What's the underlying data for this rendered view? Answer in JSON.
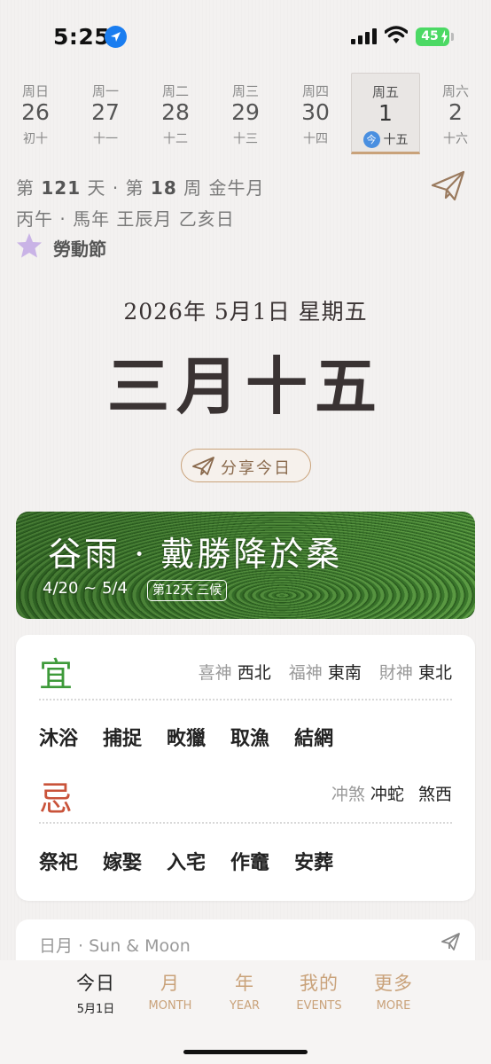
{
  "status_bar": {
    "time": "5:25",
    "battery": "45"
  },
  "week": [
    {
      "weekday": "周日",
      "date": "26",
      "lunar": "初十",
      "selected": false
    },
    {
      "weekday": "周一",
      "date": "27",
      "lunar": "十一",
      "selected": false
    },
    {
      "weekday": "周二",
      "date": "28",
      "lunar": "十二",
      "selected": false
    },
    {
      "weekday": "周三",
      "date": "29",
      "lunar": "十三",
      "selected": false
    },
    {
      "weekday": "周四",
      "date": "30",
      "lunar": "十四",
      "selected": false
    },
    {
      "weekday": "周五",
      "date": "1",
      "lunar": "十五",
      "selected": true,
      "badge": "今"
    },
    {
      "weekday": "周六",
      "date": "2",
      "lunar": "十六",
      "selected": false
    }
  ],
  "info": {
    "day_prefix": "第",
    "day_of_year": "121",
    "day_suffix": "天 · 第",
    "week_of_year": "18",
    "week_suffix": "周 金牛月",
    "ganzhi": "丙午 · 馬年 王辰月 乙亥日",
    "holiday": "勞動節"
  },
  "date": {
    "gregorian": "2026年 5月1日 星期五",
    "lunar": "三月十五"
  },
  "share_label": "分享今日",
  "solar_term": {
    "title": "谷雨 · 戴勝降於桑",
    "range": "4/20 ~ 5/4",
    "badge": "第12天 三候"
  },
  "yi_ji": {
    "yi_char": "宜",
    "ji_char": "忌",
    "xishen_label": "喜神",
    "xishen_val": "西北",
    "fushen_label": "福神",
    "fushen_val": "東南",
    "caishen_label": "財神",
    "caishen_val": "東北",
    "yi_items": [
      "沐浴",
      "捕捉",
      "畋獵",
      "取漁",
      "結網"
    ],
    "chongsha_label": "冲煞",
    "chong_val": "冲蛇",
    "sha_val": "煞西",
    "ji_items": [
      "祭祀",
      "嫁娶",
      "入宅",
      "作竈",
      "安葬"
    ]
  },
  "sun_moon": {
    "title": "日月 · Sun & Moon"
  },
  "tabs": [
    {
      "label": "今日",
      "sub": "5月1日",
      "active": true
    },
    {
      "label": "月",
      "sub": "MONTH",
      "active": false
    },
    {
      "label": "年",
      "sub": "YEAR",
      "active": false
    },
    {
      "label": "我的",
      "sub": "EVENTS",
      "active": false
    },
    {
      "label": "更多",
      "sub": "MORE",
      "active": false
    }
  ],
  "colors": {
    "accent": "#c9a27a",
    "yi": "#3e9a3a",
    "ji": "#c9533a",
    "today_badge": "#4a8fe0",
    "holiday_star": "#c9b3e6"
  },
  "icons": [
    "location-arrow-icon",
    "signal-icon",
    "wifi-icon",
    "battery-icon",
    "paper-plane-icon",
    "star-icon"
  ]
}
